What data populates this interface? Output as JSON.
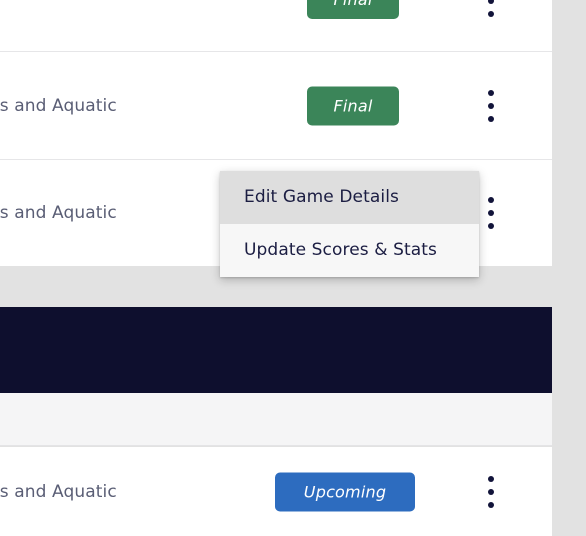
{
  "colors": {
    "page_background": "#e2e2e2",
    "row_background": "#ffffff",
    "status_final": "#3b8559",
    "status_upcoming": "#2d6cbf",
    "banner_navy": "#0e0f2e",
    "section_head": "#f5f5f6",
    "menu_background": "#f7f7f7",
    "menu_hover": "#dedede",
    "team_text": "#5a5e75",
    "menu_text": "#1b1d42"
  },
  "games_upper": [
    {
      "team": "",
      "status_label": "Final",
      "status_kind": "final",
      "kebab_icon": "kebab-menu-icon"
    },
    {
      "team": "ts and Aquatic",
      "status_label": "Final",
      "status_kind": "final",
      "kebab_icon": "kebab-menu-icon"
    },
    {
      "team": "ts and Aquatic",
      "status_label": "",
      "status_kind": "hidden",
      "kebab_icon": "kebab-menu-icon"
    }
  ],
  "games_lower": [
    {
      "team": "ts and Aquatic",
      "status_label": "Upcoming",
      "status_kind": "upcoming",
      "kebab_icon": "kebab-menu-icon"
    }
  ],
  "context_menu": {
    "visible": true,
    "items": [
      {
        "label": "Edit Game Details",
        "hovered": true
      },
      {
        "label": "Update Scores & Stats",
        "hovered": false
      }
    ]
  },
  "banner": {
    "text": ""
  },
  "section_header": {
    "text": ""
  }
}
